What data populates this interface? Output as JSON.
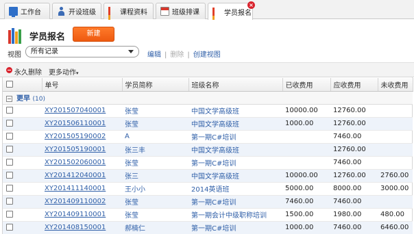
{
  "tabs": [
    {
      "label": "工作台",
      "icon": "monitor-icon"
    },
    {
      "label": "开设班级",
      "icon": "person-icon"
    },
    {
      "label": "课程资料",
      "icon": "books-icon"
    },
    {
      "label": "班级排课",
      "icon": "calendar-icon"
    },
    {
      "label": "学员报名",
      "icon": "books-icon",
      "active": true
    }
  ],
  "header": {
    "title": "学员报名",
    "new_button": "新建",
    "view_label": "视图",
    "view_selected": "所有记录",
    "link_edit": "编辑",
    "link_delete": "删除",
    "link_create": "创建视图",
    "sep": "|"
  },
  "actions": {
    "delete": "永久删除",
    "more": "更多动作"
  },
  "colors": {
    "accent": "#ee5a10",
    "link": "#2f5fa8",
    "close_badge": "#d9232d"
  },
  "table": {
    "columns": [
      "单号",
      "学员简称",
      "班级名称",
      "已收费用",
      "应收费用",
      "未收费用"
    ],
    "group": {
      "label": "更早",
      "count": "(10)",
      "toggle": "⊟"
    },
    "rows": [
      [
        "XY201507040001",
        "张莹",
        "中国文学高级班",
        "10000.00",
        "12760.00",
        ""
      ],
      [
        "XY201506110001",
        "张莹",
        "中国文学高级班",
        "1000.00",
        "12760.00",
        ""
      ],
      [
        "XY201505190002",
        "A",
        "第一期C#培训",
        "",
        "7460.00",
        ""
      ],
      [
        "XY201505190001",
        "张三丰",
        "中国文学高级班",
        "",
        "12760.00",
        ""
      ],
      [
        "XY201502060001",
        "张莹",
        "第一期C#培训",
        "",
        "7460.00",
        ""
      ],
      [
        "XY201412040001",
        "张三",
        "中国文学高级班",
        "10000.00",
        "12760.00",
        "2760.00"
      ],
      [
        "XY201411140001",
        "王小小",
        "2014英语班",
        "5000.00",
        "8000.00",
        "3000.00"
      ],
      [
        "XY201409110002",
        "张莹",
        "第一期C#培训",
        "7460.00",
        "7460.00",
        ""
      ],
      [
        "XY201409110001",
        "张莹",
        "第一期会计中级职称培训",
        "1500.00",
        "1980.00",
        "480.00"
      ],
      [
        "XY201408150001",
        "郝楠仁",
        "第一期C#培训",
        "1000.00",
        "7460.00",
        "6460.00"
      ]
    ]
  }
}
